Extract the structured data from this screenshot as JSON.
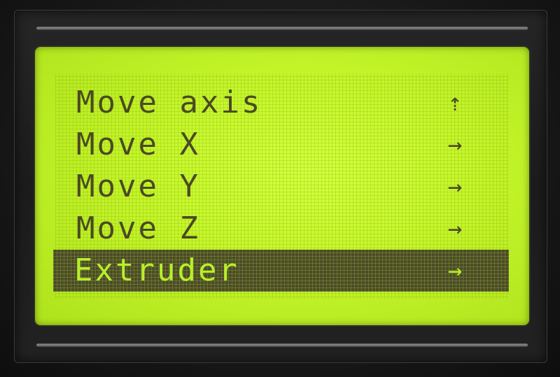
{
  "lcd_menu": {
    "items": [
      {
        "label": "Move axis",
        "indicator": "⇡",
        "indicator_icon": "up-arrow-icon",
        "selected": false
      },
      {
        "label": "Move X",
        "indicator": "→",
        "indicator_icon": "right-arrow-icon",
        "selected": false
      },
      {
        "label": "Move Y",
        "indicator": "→",
        "indicator_icon": "right-arrow-icon",
        "selected": false
      },
      {
        "label": "Move Z",
        "indicator": "→",
        "indicator_icon": "right-arrow-icon",
        "selected": false
      },
      {
        "label": "Extruder",
        "indicator": "→",
        "indicator_icon": "right-arrow-icon",
        "selected": true
      }
    ]
  },
  "colors": {
    "lcd_background": "#c4f52a",
    "lcd_text": "#4a4a22",
    "highlight_background": "#4b4b2a",
    "highlight_text": "#b9ef2a",
    "bezel": "#1c1c1c"
  }
}
